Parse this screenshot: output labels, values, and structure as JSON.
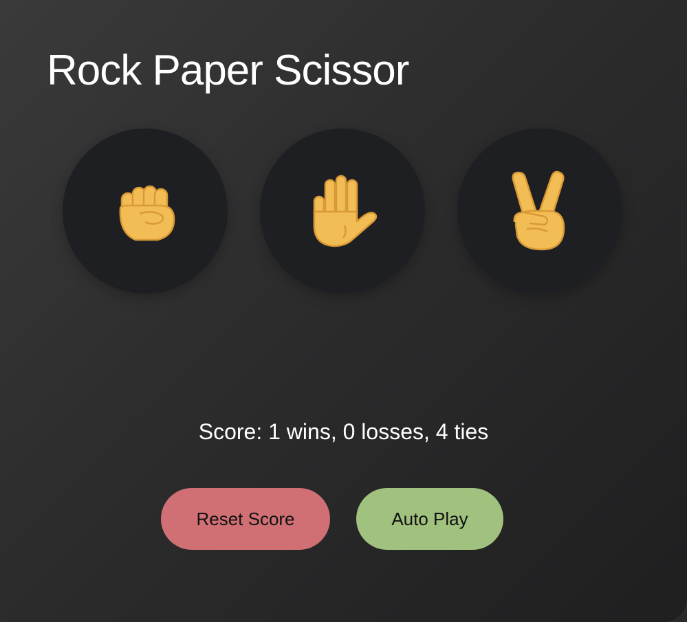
{
  "app": {
    "title": "Rock Paper Scissor"
  },
  "moves": [
    {
      "name": "rock",
      "icon": "raised-fist-icon"
    },
    {
      "name": "paper",
      "icon": "raised-hand-icon"
    },
    {
      "name": "scissors",
      "icon": "victory-hand-icon"
    }
  ],
  "score": {
    "text": "Score: 1 wins, 0 losses, 4 ties",
    "wins": 1,
    "losses": 0,
    "ties": 4
  },
  "buttons": {
    "reset_label": "Reset Score",
    "auto_play_label": "Auto Play"
  },
  "colors": {
    "card_background": "#2c2c2d",
    "move_button": "#1e1f22",
    "emoji_skin": "#f2bd55",
    "reset_button": "#d07074",
    "auto_play_button": "#a1c17f"
  }
}
